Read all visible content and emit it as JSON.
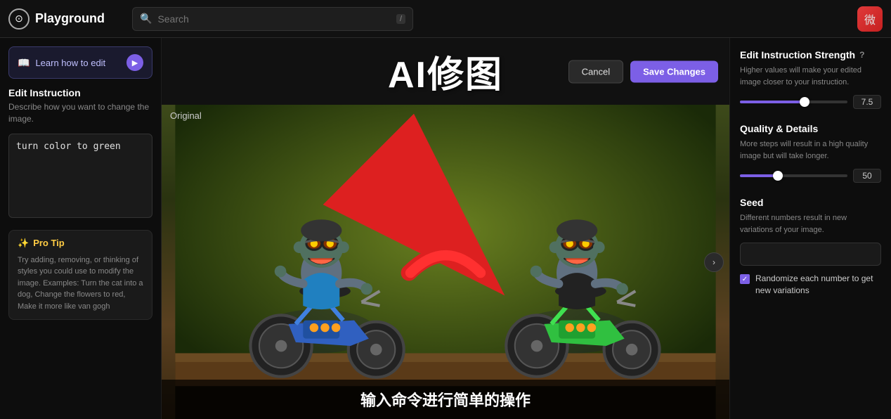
{
  "header": {
    "logo_icon": "⊙",
    "logo_text": "Playground",
    "search_placeholder": "Search",
    "search_shortcut": "/",
    "user_emoji": "微"
  },
  "sidebar": {
    "learn_btn_label": "Learn how to edit",
    "edit_instruction_title": "Edit Instruction",
    "edit_instruction_desc": "Describe how you want to change the image.",
    "instruction_value": "turn color to green",
    "pro_tip_header": "Pro Tip",
    "pro_tip_text": "Try adding, removing, or thinking of styles you could use to modify the image. Examples: Turn the cat into a dog, Change the flowers to red, Make it more like van gogh"
  },
  "canvas": {
    "title": "AI修图",
    "cancel_label": "Cancel",
    "save_label": "Save Changes",
    "original_label": "Original",
    "subtitle": "输入命令进行简单的操作"
  },
  "right_panel": {
    "strength_title": "Edit Instruction Strength",
    "strength_info": "?",
    "strength_desc": "Higher values will make your edited image closer to your instruction.",
    "strength_value": "7.5",
    "strength_percent": 60,
    "quality_title": "Quality & Details",
    "quality_desc": "More steps will result in a high quality image but will take longer.",
    "quality_value": "50",
    "quality_percent": 35,
    "seed_title": "Seed",
    "seed_desc": "Different numbers result in new variations of your image.",
    "seed_placeholder": "",
    "randomize_label": "Randomize each number to get new variations"
  }
}
